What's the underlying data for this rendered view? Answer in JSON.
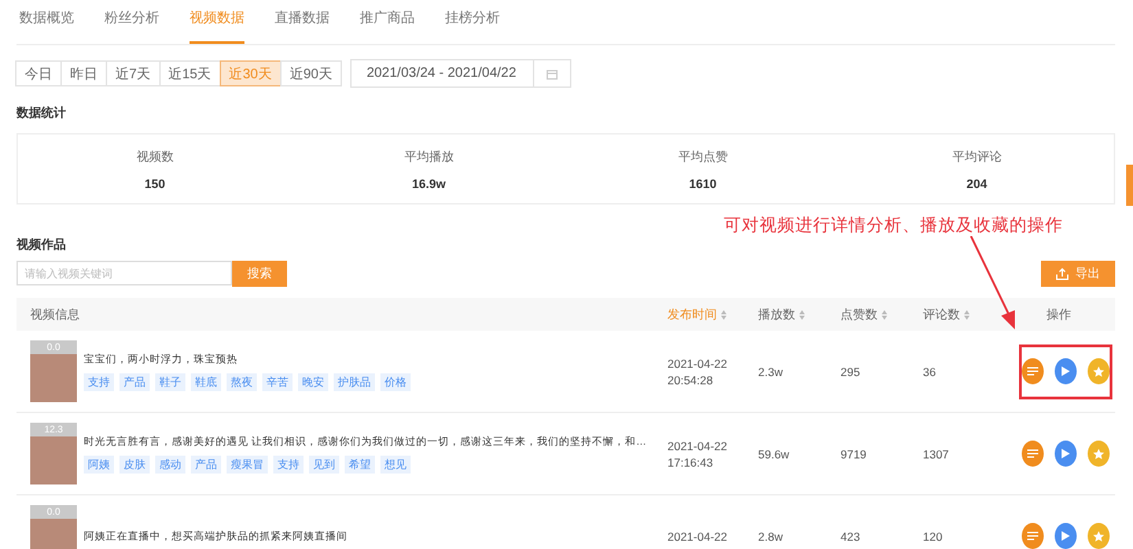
{
  "tabs": [
    {
      "label": "数据概览",
      "selected": false
    },
    {
      "label": "粉丝分析",
      "selected": false
    },
    {
      "label": "视频数据",
      "selected": true
    },
    {
      "label": "直播数据",
      "selected": false
    },
    {
      "label": "推广商品",
      "selected": false
    },
    {
      "label": "挂榜分析",
      "selected": false
    }
  ],
  "ranges": [
    {
      "label": "今日",
      "selected": false
    },
    {
      "label": "昨日",
      "selected": false
    },
    {
      "label": "近7天",
      "selected": false
    },
    {
      "label": "近15天",
      "selected": false
    },
    {
      "label": "近30天",
      "selected": true
    },
    {
      "label": "近90天",
      "selected": false
    }
  ],
  "date_range": {
    "value": "2021/03/24 - 2021/04/22"
  },
  "stats": {
    "title": "数据统计",
    "items": [
      {
        "label": "视频数",
        "value": "150"
      },
      {
        "label": "平均播放",
        "value": "16.9w"
      },
      {
        "label": "平均点赞",
        "value": "1610"
      },
      {
        "label": "平均评论",
        "value": "204"
      }
    ]
  },
  "annotation": {
    "text": "可对视频进行详情分析、播放及收藏的操作"
  },
  "videos": {
    "title": "视频作品",
    "search": {
      "placeholder": "请输入视频关键词",
      "button": "搜索"
    },
    "export_button": "导出",
    "columns": [
      {
        "label": "视频信息",
        "sortable": false,
        "sorted": false
      },
      {
        "label": "发布时间",
        "sortable": true,
        "sorted": true
      },
      {
        "label": "播放数",
        "sortable": true,
        "sorted": false
      },
      {
        "label": "点赞数",
        "sortable": true,
        "sorted": false
      },
      {
        "label": "评论数",
        "sortable": true,
        "sorted": false
      },
      {
        "label": "操作",
        "sortable": false,
        "sorted": false
      }
    ],
    "rows": [
      {
        "badge": "0.0",
        "title": "宝宝们，两小时浮力，珠宝预热",
        "tags": [
          "支持",
          "产品",
          "鞋子",
          "鞋底",
          "熬夜",
          "辛苦",
          "晚安",
          "护肤品",
          "价格"
        ],
        "date": "2021-04-22",
        "time": "20:54:28",
        "plays": "2.3w",
        "likes": "295",
        "comments": "36",
        "highlighted": true
      },
      {
        "badge": "12.3",
        "title": "时光无言胜有言，感谢美好的遇见 让我们相识，感谢你们为我们做过的一切，感谢这三年来，我们的坚持不懈，和…",
        "tags": [
          "阿姨",
          "皮肤",
          "感动",
          "产品",
          "瘦果冒",
          "支持",
          "见到",
          "希望",
          "想见"
        ],
        "date": "2021-04-22",
        "time": "17:16:43",
        "plays": "59.6w",
        "likes": "9719",
        "comments": "1307",
        "highlighted": false
      },
      {
        "badge": "0.0",
        "title": "阿姨正在直播中，想买高端护肤品的抓紧来阿姨直播间",
        "tags": [],
        "date": "2021-04-22",
        "time": "",
        "plays": "2.8w",
        "likes": "423",
        "comments": "120",
        "highlighted": false
      }
    ]
  }
}
